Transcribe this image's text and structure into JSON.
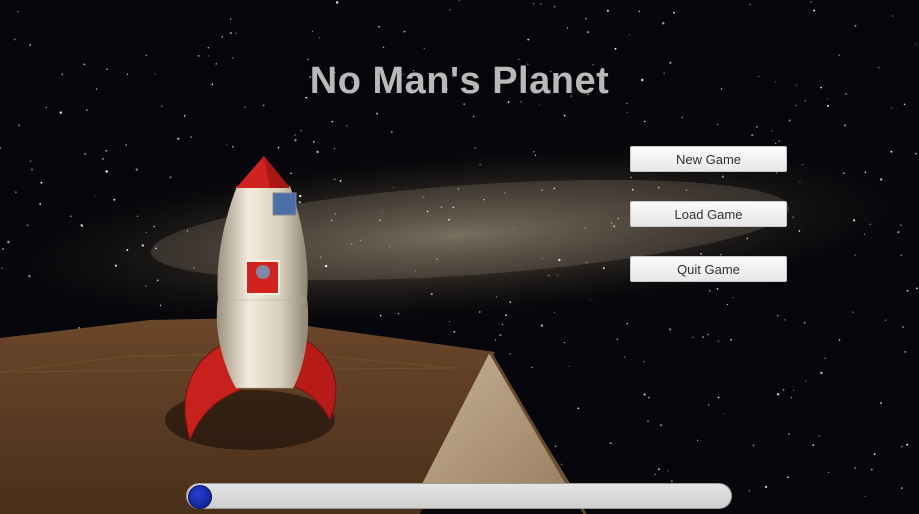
{
  "game": {
    "title": "No Man's Planet"
  },
  "menu": {
    "new_game": "New Game",
    "load_game": "Load Game",
    "quit_game": "Quit Game"
  },
  "slider": {
    "value": 0.0
  },
  "colors": {
    "title": "#b9b9b9",
    "rocket_red": "#c8201c",
    "rocket_body": "#e6dccb",
    "ground": "#5a3b22",
    "slider_handle": "#0a1a8a"
  },
  "icons": [
    "rocket-icon",
    "slider-handle-icon"
  ]
}
